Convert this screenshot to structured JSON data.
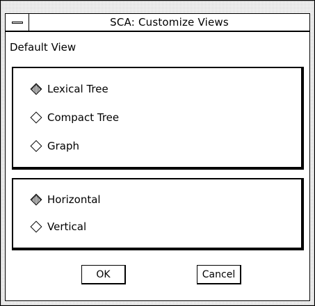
{
  "window": {
    "title": "SCA: Customize Views"
  },
  "dialog": {
    "heading": "Default View",
    "view_options": [
      {
        "label": "Lexical Tree",
        "selected": true
      },
      {
        "label": "Compact Tree",
        "selected": false
      },
      {
        "label": "Graph",
        "selected": false
      }
    ],
    "orientation_options": [
      {
        "label": "Horizontal",
        "selected": true
      },
      {
        "label": "Vertical",
        "selected": false
      }
    ],
    "buttons": {
      "ok": "OK",
      "cancel": "Cancel"
    }
  },
  "icons": {
    "window_menu": "window-menu-icon",
    "radio": "diamond-radio-icon"
  }
}
